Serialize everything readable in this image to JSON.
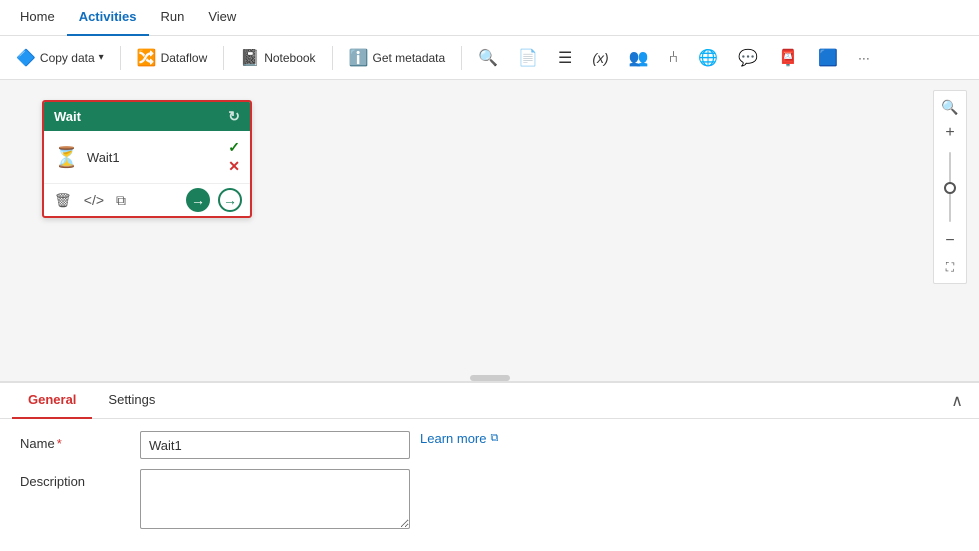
{
  "menuBar": {
    "items": [
      {
        "id": "home",
        "label": "Home",
        "active": false
      },
      {
        "id": "activities",
        "label": "Activities",
        "active": true
      },
      {
        "id": "run",
        "label": "Run",
        "active": false
      },
      {
        "id": "view",
        "label": "View",
        "active": false
      }
    ]
  },
  "toolbar": {
    "copyDataLabel": "Copy data",
    "dataflowLabel": "Dataflow",
    "notebookLabel": "Notebook",
    "getMetadataLabel": "Get metadata",
    "moreIcon": "···"
  },
  "canvas": {
    "activityNode": {
      "title": "Wait",
      "name": "Wait1",
      "icon": "⏳"
    }
  },
  "bottomPanel": {
    "tabs": [
      {
        "id": "general",
        "label": "General",
        "active": true
      },
      {
        "id": "settings",
        "label": "Settings",
        "active": false
      }
    ],
    "form": {
      "nameLabel": "Name",
      "nameValue": "Wait1",
      "namePlaceholder": "",
      "requiredStar": "*",
      "descriptionLabel": "Description",
      "descriptionValue": "",
      "descriptionPlaceholder": "",
      "learnMoreLabel": "Learn more",
      "learnMoreIcon": "⧉"
    }
  },
  "zoom": {
    "searchIcon": "🔍",
    "plusIcon": "+",
    "minusIcon": "−",
    "fitIcon": "⛶"
  }
}
